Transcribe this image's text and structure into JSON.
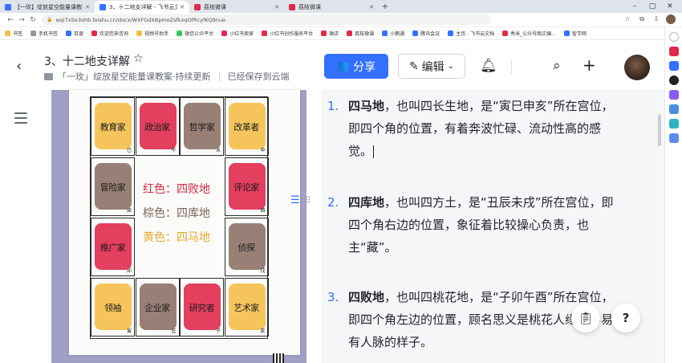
{
  "browser": {
    "tabs": [
      {
        "label": "【一玫】绽放星空能量课教案·持续",
        "color": "#3370ff",
        "active": false
      },
      {
        "label": "3、十二地支详解 - 飞书云文档",
        "color": "#3370ff",
        "active": true
      },
      {
        "label": "荔枝微课",
        "color": "#e02a4d",
        "active": false
      },
      {
        "label": "荔枝微课",
        "color": "#e02a4d",
        "active": false
      }
    ],
    "new_tab": "+",
    "url": "wqi7x5e3ohb.feishu.cn/docx/WXFGdXBpmoZsfkxqOfRcyfKQ9nue",
    "bookmarks": [
      {
        "label": "书签",
        "color": "#f4bf4a"
      },
      {
        "label": "手机书签",
        "color": "#8f959e"
      },
      {
        "label": "百度",
        "color": "#3370ff"
      },
      {
        "label": "欢迎您来咨询",
        "color": "#e02a4d"
      },
      {
        "label": "视频号助手",
        "color": "#f4bf4a"
      },
      {
        "label": "微信公众平台",
        "color": "#34c759"
      },
      {
        "label": "小红书卖家",
        "color": "#e02a4d"
      },
      {
        "label": "小红书创作服务平台",
        "color": "#e02a4d"
      },
      {
        "label": "微店",
        "color": "#e02a4d"
      },
      {
        "label": "荔枝微课",
        "color": "#e02a4d"
      },
      {
        "label": "小鹅通",
        "color": "#3370ff"
      },
      {
        "label": "腾讯会议",
        "color": "#3370ff"
      },
      {
        "label": "主页 - 飞书云文档",
        "color": "#3370ff"
      },
      {
        "label": "秀米_公众号图文编...",
        "color": "#e02a4d"
      },
      {
        "label": "智学网",
        "color": "#3370ff"
      }
    ]
  },
  "doc": {
    "back": "‹",
    "title": "3、十二地支详解",
    "star": "☆",
    "folder": "「一玫」绽放星空能量课教案·持续更新",
    "saved": "已经保存到云端",
    "share_label": "分享",
    "edit_label": "编辑"
  },
  "image": {
    "cells": [
      {
        "text": "教育家",
        "branch": "巳",
        "color": "yellow",
        "col": 0,
        "row": 0
      },
      {
        "text": "政治家",
        "branch": "午",
        "color": "red",
        "col": 1,
        "row": 0
      },
      {
        "text": "哲学家",
        "branch": "未",
        "color": "brown",
        "col": 2,
        "row": 0
      },
      {
        "text": "改革者",
        "branch": "申",
        "color": "yellow",
        "col": 3,
        "row": 0
      },
      {
        "text": "冒险家",
        "branch": "辰",
        "color": "brown",
        "col": 0,
        "row": 1
      },
      {
        "text": "评论家",
        "branch": "酉",
        "color": "red",
        "col": 3,
        "row": 1
      },
      {
        "text": "推广家",
        "branch": "卯",
        "color": "red",
        "col": 0,
        "row": 2
      },
      {
        "text": "侦探",
        "branch": "戌",
        "color": "brown",
        "col": 3,
        "row": 2
      },
      {
        "text": "领袖",
        "branch": "寅",
        "color": "yellow",
        "col": 0,
        "row": 3
      },
      {
        "text": "企业家",
        "branch": "丑",
        "color": "brown",
        "col": 1,
        "row": 3
      },
      {
        "text": "研究者",
        "branch": "子",
        "color": "red",
        "col": 2,
        "row": 3
      },
      {
        "text": "艺术家",
        "branch": "亥",
        "color": "yellow",
        "col": 3,
        "row": 3
      }
    ],
    "legend": [
      {
        "text": "红色：四败地",
        "color": "#d8263f"
      },
      {
        "text": "棕色：四库地",
        "color": "#7d6258"
      },
      {
        "text": "黄色：四马地",
        "color": "#e6a92d"
      }
    ],
    "colors": {
      "yellow": "#f4bf4a",
      "red": "#e02a4d",
      "brown": "#8d7268"
    }
  },
  "list": [
    {
      "num": "1.",
      "title": "四马地",
      "body": "，也叫四长生地，是“寅巳申亥”所在宫位，即四个角的位置，有着奔波忙碌、流动性高的感觉。"
    },
    {
      "num": "2.",
      "title": "四库地",
      "body": "，也叫四方土，是“丑辰未戌”所在宫位，即四个角右边的位置，象征着比较操心负责，也主“藏”。"
    },
    {
      "num": "3.",
      "title": "四败地",
      "body": "，也叫四桃花地，是“子卯午酉”所在宫位，即四个角左边的位置，顾名思义是桃花人缘、容易有人脉的样子。"
    }
  ],
  "accent": "#3370ff"
}
